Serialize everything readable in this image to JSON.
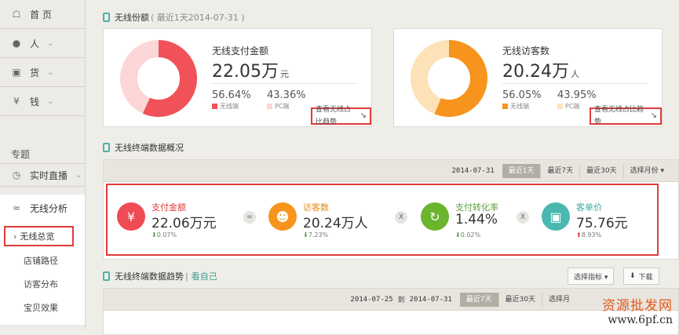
{
  "sidebar": {
    "items": [
      {
        "icon": "home-icon",
        "label": "首 页"
      },
      {
        "icon": "user-icon",
        "label": "人"
      },
      {
        "icon": "bag-icon",
        "label": "货"
      },
      {
        "icon": "yen-icon",
        "label": "钱"
      }
    ],
    "topic_title": "专题",
    "live_label": "实时直播",
    "wireless_label": "无线分析",
    "wireless_sub": [
      "无线总览",
      "店铺路径",
      "访客分布",
      "宝贝效果"
    ]
  },
  "share": {
    "title": "无线份额",
    "subtitle": "( 最近1天2014-07-31 )",
    "pay": {
      "title": "无线支付金额",
      "value": "22.05",
      "unit_big": "万",
      "unit_small": "元",
      "pct_wireless": "56.64%",
      "pct_pc": "43.36%",
      "legend_wireless": "无线端",
      "legend_pc": "PC端",
      "share_wireless": 0.5664,
      "color_wireless": "#f1525a",
      "color_pc": "#fcd6d6",
      "trend": "查看无线占比趋势"
    },
    "visitors": {
      "title": "无线访客数",
      "value": "20.24",
      "unit_big": "万",
      "unit_small": "人",
      "pct_wireless": "56.05%",
      "pct_pc": "43.95%",
      "legend_wireless": "无线端",
      "legend_pc": "PC端",
      "share_wireless": 0.5605,
      "color_wireless": "#f7941d",
      "color_pc": "#fde2b8",
      "trend": "查看无线占比趋势"
    }
  },
  "overview": {
    "title": "无线终端数据概况",
    "date": "2014-07-31",
    "buttons": [
      "最近1天",
      "最近7天",
      "最近30天",
      "选择月份 ▾"
    ],
    "kpis": [
      {
        "label": "支付金额",
        "value": "22.06万元",
        "delta": "0.07%",
        "dir": "down",
        "label_color": "#e23a3a",
        "icon_color": "#ef4b55",
        "glyph": "¥"
      },
      {
        "label": "访客数",
        "value": "20.24万人",
        "delta": "7.23%",
        "dir": "down",
        "label_color": "#e58a13",
        "icon_color": "#f7941d",
        "glyph": "●"
      },
      {
        "label": "支付转化率",
        "value": "1.44%",
        "delta": "0.02%",
        "dir": "down",
        "label_color": "#5aa13a",
        "icon_color": "#6ab42e",
        "glyph": "↻"
      },
      {
        "label": "客单价",
        "value": "75.76元",
        "delta": "8.93%",
        "dir": "up",
        "label_color": "#3ba99f",
        "icon_color": "#4ab8b0",
        "glyph": "▣"
      }
    ],
    "ops": [
      "=",
      "X",
      "X"
    ]
  },
  "trend": {
    "title": "无线终端数据趋势",
    "link": "看自己",
    "select_metric": "选择指标 ▾",
    "download": "下载",
    "date_from": "2014-07-25",
    "to_word": "到",
    "date_to": "2014-07-31",
    "buttons": [
      "最近7天",
      "最近30天",
      "选择月"
    ]
  },
  "watermark": {
    "cn": "资源批发网",
    "url": "www.6pf.cn"
  }
}
